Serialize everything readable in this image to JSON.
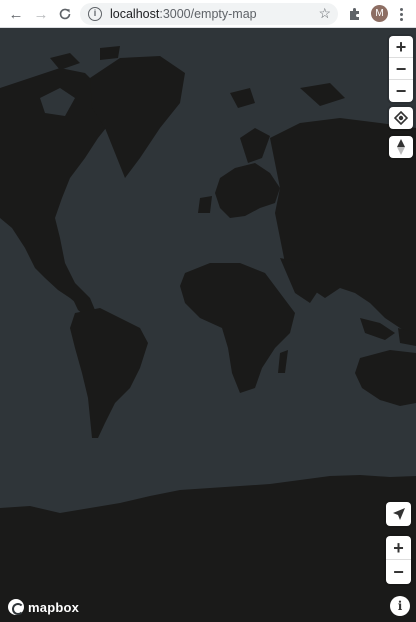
{
  "browser": {
    "url_host": "localhost",
    "url_path": ":3000/empty-map",
    "avatar_letter": "M",
    "icons": [
      "back-arrow-icon",
      "forward-arrow-icon",
      "reload-icon",
      "info-icon",
      "star-icon",
      "puzzle-icon",
      "kebab-menu-icon"
    ]
  },
  "map": {
    "colors": {
      "water": "#2f3539",
      "land": "#1a1a19"
    },
    "top_controls": {
      "zoom_in": "+",
      "zoom_out": "−",
      "zoom_out_alt": "−"
    },
    "bottom_controls": {
      "zoom_in": "+",
      "zoom_out": "−"
    },
    "logo_text": "mapbox",
    "attribution_symbol": "i"
  }
}
